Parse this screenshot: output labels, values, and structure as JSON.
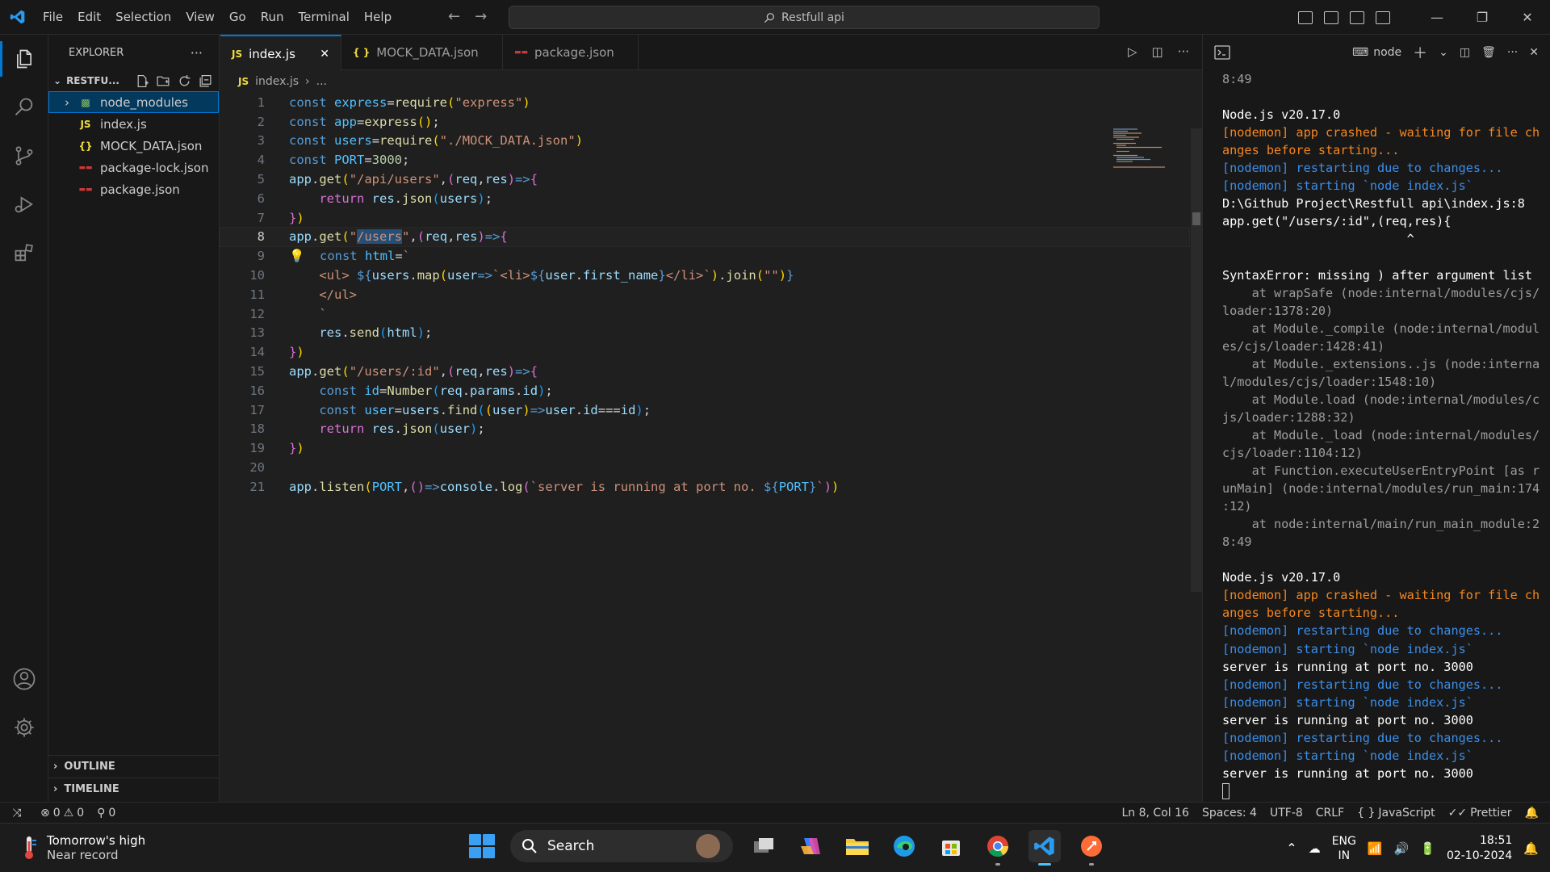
{
  "titlebar": {
    "menu": [
      "File",
      "Edit",
      "Selection",
      "View",
      "Go",
      "Run",
      "Terminal",
      "Help"
    ],
    "search": "Restfull api"
  },
  "sidebar": {
    "title": "EXPLORER",
    "folder": "RESTFU...",
    "items": [
      {
        "label": "node_modules",
        "icon": "folder-node-icon"
      },
      {
        "label": "index.js",
        "icon": "js-file-icon"
      },
      {
        "label": "MOCK_DATA.json",
        "icon": "json-file-icon"
      },
      {
        "label": "package-lock.json",
        "icon": "npm-file-icon"
      },
      {
        "label": "package.json",
        "icon": "npm-file-icon"
      }
    ],
    "outline": "OUTLINE",
    "timeline": "TIMELINE"
  },
  "tabs": [
    {
      "label": "index.js",
      "icon": "JS"
    },
    {
      "label": "MOCK_DATA.json",
      "icon": "{ }"
    },
    {
      "label": "package.json",
      "icon": "npm"
    }
  ],
  "breadcrumb": {
    "file": "index.js",
    "rest": "..."
  },
  "code": [
    "const express=require(\"express\")",
    "const app=express();",
    "const users=require(\"./MOCK_DATA.json\")",
    "const PORT=3000;",
    "app.get(\"/api/users\",(req,res)=>{",
    "    return res.json(users);",
    "})",
    "app.get(\"/users\",(req,res)=>{",
    "    const html=`",
    "    <ul> ${users.map(user=>`<li>${user.first_name}</li>`).join(\"\")}",
    "    </ul>",
    "    `",
    "    res.send(html);",
    "})",
    "app.get(\"/users/:id\",(req,res)=>{",
    "    const id=Number(req.params.id);",
    "    const user=users.find((user)=>user.id===id);",
    "    return res.json(user);",
    "})",
    "",
    "app.listen(PORT,()=>console.log(`server is running at port no. ${PORT}`))"
  ],
  "terminal": {
    "shell": "node",
    "lines": [
      {
        "t": "8:49",
        "c": "stack"
      },
      {
        "t": "",
        "c": ""
      },
      {
        "t": "Node.js v20.17.0",
        "c": "w"
      },
      {
        "t": "[nodemon] app crashed - waiting for file ch",
        "c": "orange"
      },
      {
        "t": "anges before starting...",
        "c": "orange"
      },
      {
        "t": "[nodemon] restarting due to changes...",
        "c": "info"
      },
      {
        "t": "[nodemon] starting `node index.js`",
        "c": "info"
      },
      {
        "t": "D:\\Github Project\\Restfull api\\index.js:8",
        "c": "w"
      },
      {
        "t": "app.get(\"/users/:id\",(req,res){",
        "c": "w"
      },
      {
        "t": "                         ^",
        "c": "w"
      },
      {
        "t": "",
        "c": ""
      },
      {
        "t": "SyntaxError: missing ) after argument list",
        "c": "w"
      },
      {
        "t": "    at wrapSafe (node:internal/modules/cjs/",
        "c": "stack"
      },
      {
        "t": "loader:1378:20)",
        "c": "stack"
      },
      {
        "t": "    at Module._compile (node:internal/modul",
        "c": "stack"
      },
      {
        "t": "es/cjs/loader:1428:41)",
        "c": "stack"
      },
      {
        "t": "    at Module._extensions..js (node:interna",
        "c": "stack"
      },
      {
        "t": "l/modules/cjs/loader:1548:10)",
        "c": "stack"
      },
      {
        "t": "    at Module.load (node:internal/modules/c",
        "c": "stack"
      },
      {
        "t": "js/loader:1288:32)",
        "c": "stack"
      },
      {
        "t": "    at Module._load (node:internal/modules/",
        "c": "stack"
      },
      {
        "t": "cjs/loader:1104:12)",
        "c": "stack"
      },
      {
        "t": "    at Function.executeUserEntryPoint [as r",
        "c": "stack"
      },
      {
        "t": "unMain] (node:internal/modules/run_main:174",
        "c": "stack"
      },
      {
        "t": ":12)",
        "c": "stack"
      },
      {
        "t": "    at node:internal/main/run_main_module:2",
        "c": "stack"
      },
      {
        "t": "8:49",
        "c": "stack"
      },
      {
        "t": "",
        "c": ""
      },
      {
        "t": "Node.js v20.17.0",
        "c": "w"
      },
      {
        "t": "[nodemon] app crashed - waiting for file ch",
        "c": "orange"
      },
      {
        "t": "anges before starting...",
        "c": "orange"
      },
      {
        "t": "[nodemon] restarting due to changes...",
        "c": "info"
      },
      {
        "t": "[nodemon] starting `node index.js`",
        "c": "info"
      },
      {
        "t": "server is running at port no. 3000",
        "c": "w"
      },
      {
        "t": "[nodemon] restarting due to changes...",
        "c": "info"
      },
      {
        "t": "[nodemon] starting `node index.js`",
        "c": "info"
      },
      {
        "t": "server is running at port no. 3000",
        "c": "w"
      },
      {
        "t": "[nodemon] restarting due to changes...",
        "c": "info"
      },
      {
        "t": "[nodemon] starting `node index.js`",
        "c": "info"
      },
      {
        "t": "server is running at port no. 3000",
        "c": "w"
      }
    ]
  },
  "statusbar": {
    "errors": "0",
    "warnings": "0",
    "ports": "0",
    "position": "Ln 8, Col 16",
    "spaces": "Spaces: 4",
    "encoding": "UTF-8",
    "eol": "CRLF",
    "language": "JavaScript",
    "formatter": "Prettier"
  },
  "taskbar": {
    "weather_title": "Tomorrow's high",
    "weather_sub": "Near record",
    "search": "Search",
    "lang1": "ENG",
    "lang2": "IN",
    "time": "18:51",
    "date": "02-10-2024"
  },
  "colors": {
    "accent": "#0078d4",
    "bg": "#1f1f1f",
    "panel": "#181818"
  }
}
